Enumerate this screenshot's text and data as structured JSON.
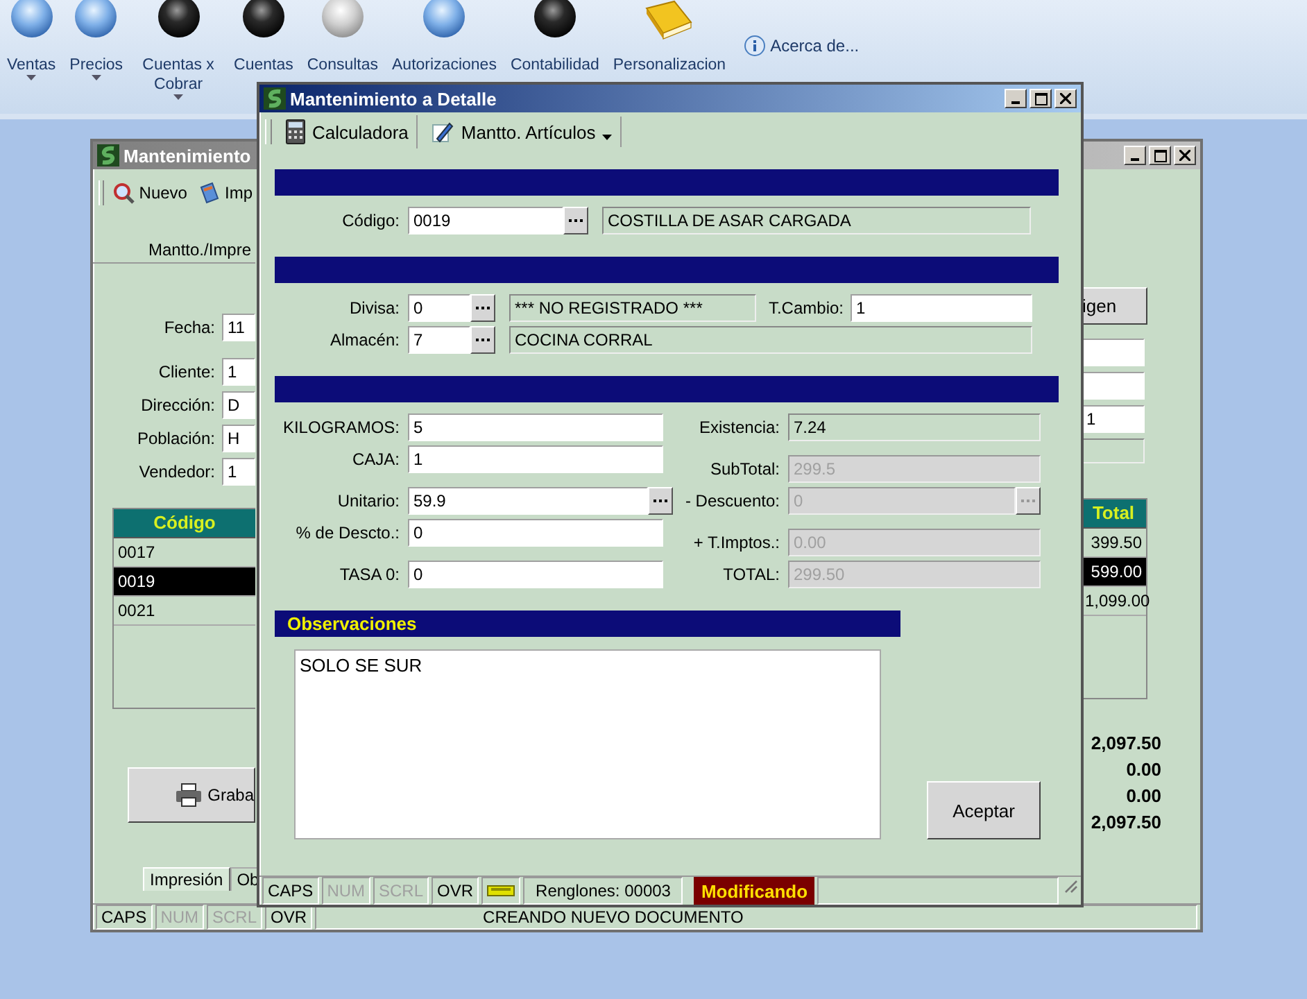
{
  "ribbon": {
    "items": [
      {
        "label": "Ventas",
        "kind": "blue_sphere",
        "dropdown": true
      },
      {
        "label": "Precios",
        "kind": "blue_sphere",
        "dropdown": true
      },
      {
        "label": "Cuentas x Cobrar",
        "kind": "black_sphere",
        "dropdown": true
      },
      {
        "label": "Cuentas",
        "kind": "black_sphere",
        "dropdown": false
      },
      {
        "label": "Consultas",
        "kind": "silver_sphere",
        "dropdown": false
      },
      {
        "label": "Autorizaciones",
        "kind": "blue_sphere",
        "dropdown": false
      },
      {
        "label": "Contabilidad",
        "kind": "black_sphere",
        "dropdown": false
      },
      {
        "label": "Personalizacion",
        "kind": "book",
        "dropdown": false
      }
    ],
    "about": "Acerca de..."
  },
  "background_window": {
    "title": "Mantenimiento",
    "toolbar": [
      {
        "label": "Nuevo",
        "kind": "new"
      },
      {
        "label": "Imp",
        "kind": "print"
      }
    ],
    "tab": "Mantto./Impre",
    "fields": [
      {
        "label": "Fecha:",
        "value": "11"
      },
      {
        "label": "Cliente:",
        "value": "1"
      },
      {
        "label": "Dirección:",
        "value": "D"
      },
      {
        "label": "Población:",
        "value": "H"
      },
      {
        "label": "Vendedor:",
        "value": "1"
      }
    ],
    "origin_button": "igen",
    "right_fields": [
      {
        "kind": "input"
      },
      {
        "kind": "input"
      },
      {
        "kind": "input",
        "value": "1"
      },
      {
        "kind": "readonly"
      }
    ],
    "grid": {
      "columns": [
        "Código",
        "Total"
      ],
      "rows": [
        {
          "code": "0017",
          "total": "399.50",
          "selected": false
        },
        {
          "code": "0019",
          "total": "599.00",
          "selected": true
        },
        {
          "code": "0021",
          "total": "1,099.00",
          "selected": false
        }
      ]
    },
    "totals": [
      "2,097.50",
      "0.00",
      "0.00",
      "2,097.50"
    ],
    "save_button": "Graba",
    "bottom_tabs": [
      {
        "label": "Impresión",
        "selected": true
      },
      {
        "label": "Ob",
        "selected": false
      }
    ],
    "status_bar": {
      "keys": [
        {
          "label": "CAPS",
          "enabled": true
        },
        {
          "label": "NUM",
          "enabled": false
        },
        {
          "label": "SCRL",
          "enabled": false
        },
        {
          "label": "OVR",
          "enabled": true
        }
      ],
      "message": "CREANDO NUEVO DOCUMENTO"
    }
  },
  "dialog": {
    "title": "Mantenimiento a Detalle",
    "toolbar": [
      {
        "label": "Calculadora",
        "kind": "calculator",
        "dropdown": false
      },
      {
        "label": "Mantto. Artículos",
        "kind": "pencil",
        "dropdown": true
      }
    ],
    "product": {
      "label": "Código:",
      "value": "0019",
      "description": "COSTILLA DE ASAR CARGADA"
    },
    "currency": {
      "label": "Divisa:",
      "value": "0",
      "description": "*** NO REGISTRADO ***",
      "rate_label": "T.Cambio:",
      "rate": "1"
    },
    "warehouse": {
      "label": "Almacén:",
      "value": "7",
      "description": "COCINA CORRAL"
    },
    "left_fields": [
      {
        "label": "KILOGRAMOS:",
        "value": "5",
        "kind": "input",
        "lookup": false
      },
      {
        "label": "CAJA:",
        "value": "1",
        "kind": "input",
        "lookup": false
      },
      {
        "label": "Unitario:",
        "value": "59.9",
        "kind": "input",
        "lookup": true
      },
      {
        "label": "% de Descto.:",
        "value": "0",
        "kind": "input",
        "lookup": false
      },
      {
        "label": "TASA 0:",
        "value": "0",
        "kind": "input",
        "lookup": false
      }
    ],
    "right_fields": [
      {
        "label": "Existencia:",
        "value": "7.24",
        "kind": "readonly",
        "lookup": false
      },
      {
        "label": "SubTotal:",
        "value": "299.5",
        "kind": "disabled",
        "lookup": false
      },
      {
        "label": "- Descuento:",
        "value": "0",
        "kind": "disabled",
        "lookup": true
      },
      {
        "label": "+ T.Imptos.:",
        "value": "0.00",
        "kind": "disabled",
        "lookup": false
      },
      {
        "label": "TOTAL:",
        "value": "299.50",
        "kind": "disabled",
        "lookup": false
      }
    ],
    "notes": {
      "title": "Observaciones",
      "text": "SOLO SE SUR"
    },
    "accept_button": "Aceptar",
    "status_bar": {
      "keys": [
        {
          "label": "CAPS",
          "enabled": true
        },
        {
          "label": "NUM",
          "enabled": false
        },
        {
          "label": "SCRL",
          "enabled": false
        },
        {
          "label": "OVR",
          "enabled": true
        }
      ],
      "rows": "Renglones: 00003",
      "mode": "Modificando"
    }
  }
}
